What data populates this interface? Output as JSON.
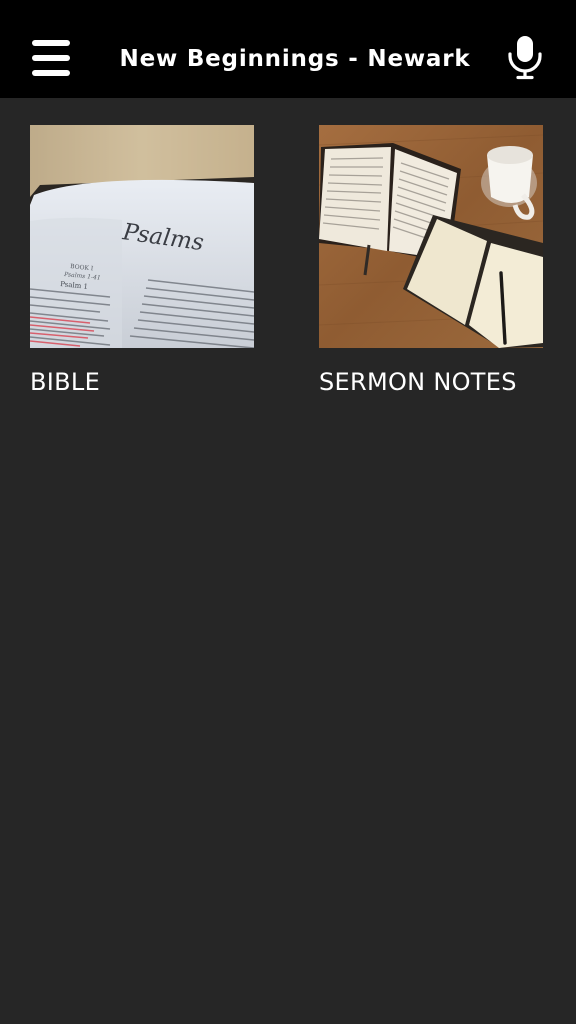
{
  "header": {
    "title": "New Beginnings - Newark",
    "menu_icon": "hamburger-menu-icon",
    "mic_icon": "microphone-icon"
  },
  "tiles": [
    {
      "label": "BIBLE",
      "image": "open-bible-psalms-image",
      "image_text": {
        "heading": "Psalms",
        "book": "BOOK I",
        "range": "Psalms 1-41",
        "psalm": "Psalm 1"
      }
    },
    {
      "label": "SERMON NOTES",
      "image": "bible-notebook-coffee-image"
    }
  ],
  "colors": {
    "header_bg": "#000000",
    "page_bg": "#262626",
    "text": "#ffffff"
  }
}
